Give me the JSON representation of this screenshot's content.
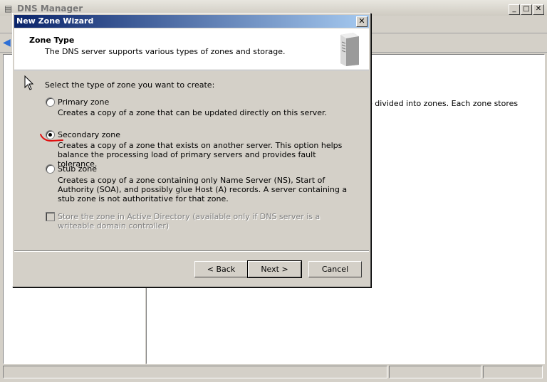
{
  "main_window": {
    "title": "DNS Manager",
    "right_pane_text": "e divided into zones. Each zone stores"
  },
  "dialog": {
    "title": "New Zone Wizard",
    "close_glyph": "✕",
    "header": {
      "title": "Zone Type",
      "subtitle": "The DNS server supports various types of zones and storage."
    },
    "prompt": "Select the type of zone you want to create:",
    "options": [
      {
        "label": "Primary zone",
        "description": "Creates a copy of a zone that can be updated directly on this server.",
        "selected": false
      },
      {
        "label": "Secondary zone",
        "description": "Creates a copy of a zone that exists on another server. This option helps balance the processing load of primary servers and provides fault tolerance.",
        "selected": true
      },
      {
        "label": "Stub zone",
        "description": "Creates a copy of a zone containing only Name Server (NS), Start of Authority (SOA), and possibly glue Host (A) records. A server containing a stub zone is not authoritative for that zone.",
        "selected": false
      }
    ],
    "store_in_ad": {
      "label": "Store the zone in Active Directory (available only if DNS server is a writeable domain controller)",
      "checked": false,
      "enabled": false
    },
    "buttons": {
      "back": "< Back",
      "next": "Next >",
      "cancel": "Cancel"
    }
  },
  "icons": {
    "server": "server-icon",
    "cursor": "mouse-pointer-icon",
    "annotation": "red-underline-annotation",
    "back": "back-arrow-icon"
  },
  "colors": {
    "titlebar_start": "#0a246a",
    "titlebar_end": "#a6caf0",
    "annotation": "#e01010"
  }
}
